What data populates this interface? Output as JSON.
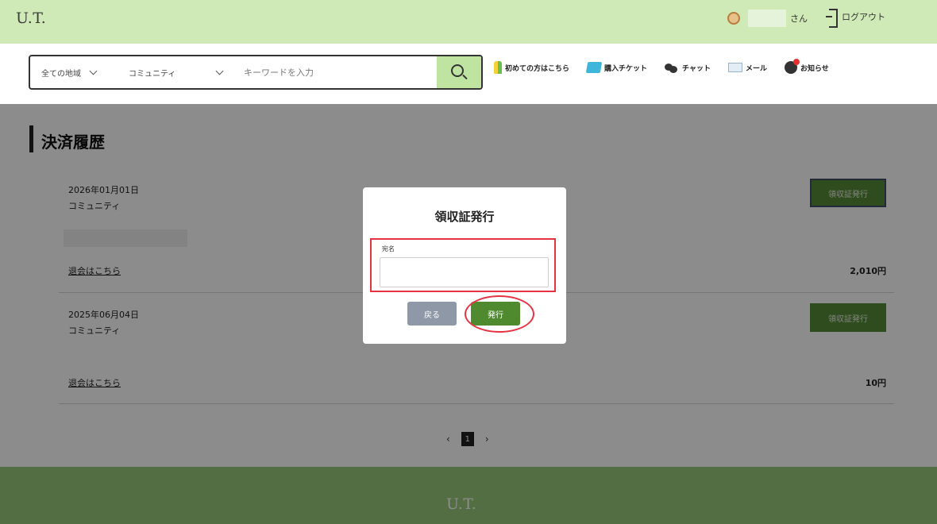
{
  "header": {
    "logo": "U.T.",
    "user_suffix": "さん",
    "logout_label": "ログアウト"
  },
  "search": {
    "region_select": "全ての地域",
    "category_select": "コミュニティ",
    "keyword_placeholder": "キーワードを入力"
  },
  "nav": {
    "items": [
      {
        "label": "初めての方はこちら",
        "icon": "beginner-icon"
      },
      {
        "label": "購入チケット",
        "icon": "ticket-icon"
      },
      {
        "label": "チャット",
        "icon": "chat-icon"
      },
      {
        "label": "メール",
        "icon": "mail-icon"
      },
      {
        "label": "お知らせ",
        "icon": "bell-icon"
      }
    ]
  },
  "page": {
    "title": "決済履歴"
  },
  "payments": [
    {
      "date": "2026年01月01日",
      "community": "コミュニティ",
      "link": "退会はこちら",
      "amount": "2,010円",
      "button": "領収証発行"
    },
    {
      "date": "2025年06月04日",
      "community": "コミュニティ",
      "link": "退会はこちら",
      "amount": "10円",
      "button": "領収証発行"
    }
  ],
  "pagination": {
    "prev": "‹",
    "current": "1",
    "next": "›"
  },
  "footer": {
    "logo": "U.T."
  },
  "modal": {
    "title": "領収証発行",
    "field_label": "宛名",
    "field_value": "",
    "back_label": "戻る",
    "issue_label": "発行"
  },
  "colors": {
    "topbar": "#cfeab6",
    "search_button": "#bfe3a0",
    "primary_button": "#4f8a2f",
    "footer": "#97c878",
    "highlight": "#e53341"
  }
}
